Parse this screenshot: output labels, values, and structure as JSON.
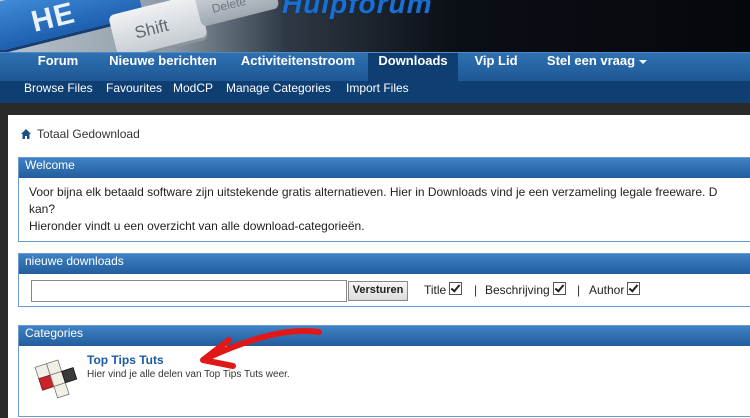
{
  "header": {
    "key_label_1": "HE",
    "key_label_2": "Shift",
    "key_label_3": "Delete",
    "site_logo_text": "Hulpforum"
  },
  "nav": {
    "items": [
      {
        "label": "Forum"
      },
      {
        "label": "Nieuwe berichten"
      },
      {
        "label": "Activiteitenstroom"
      },
      {
        "label": "Downloads"
      },
      {
        "label": "Vip Lid"
      },
      {
        "label": "Stel een vraag"
      }
    ],
    "active": "Downloads"
  },
  "subnav": {
    "items": [
      {
        "label": "Browse Files"
      },
      {
        "label": "Favourites"
      },
      {
        "label": "ModCP"
      },
      {
        "label": "Manage Categories"
      },
      {
        "label": "Import Files"
      }
    ]
  },
  "breadcrumb": {
    "label": "Totaal Gedownload",
    "icon": "home-icon"
  },
  "welcome": {
    "title": "Welcome",
    "line1": "Voor bijna elk betaald software zijn uitstekende gratis alternatieven. Hier in Downloads vind je een verzameling legale freeware. D",
    "line2": "kan?",
    "line3": "Hieronder vindt u een overzicht van alle download-categorieën."
  },
  "search": {
    "title": "nieuwe downloads",
    "value": "",
    "button_label": "Versturen",
    "options": [
      {
        "label": "Title",
        "checked": true
      },
      {
        "label": "Beschrijving",
        "checked": true
      },
      {
        "label": "Author",
        "checked": true
      }
    ],
    "separator": "|"
  },
  "categories": {
    "title": "Categories",
    "items": [
      {
        "title": "Top Tips Tuts",
        "description": "Hier vind je alle delen van Top Tips Tuts weer.",
        "icon": "scrabble-tiles-icon"
      }
    ]
  },
  "colors": {
    "nav_bar": "#1d5794",
    "nav_active": "#0f3f72",
    "panel_header": "#2f6fb0",
    "link": "#1c5aa3",
    "annotation_arrow": "#e01818"
  }
}
